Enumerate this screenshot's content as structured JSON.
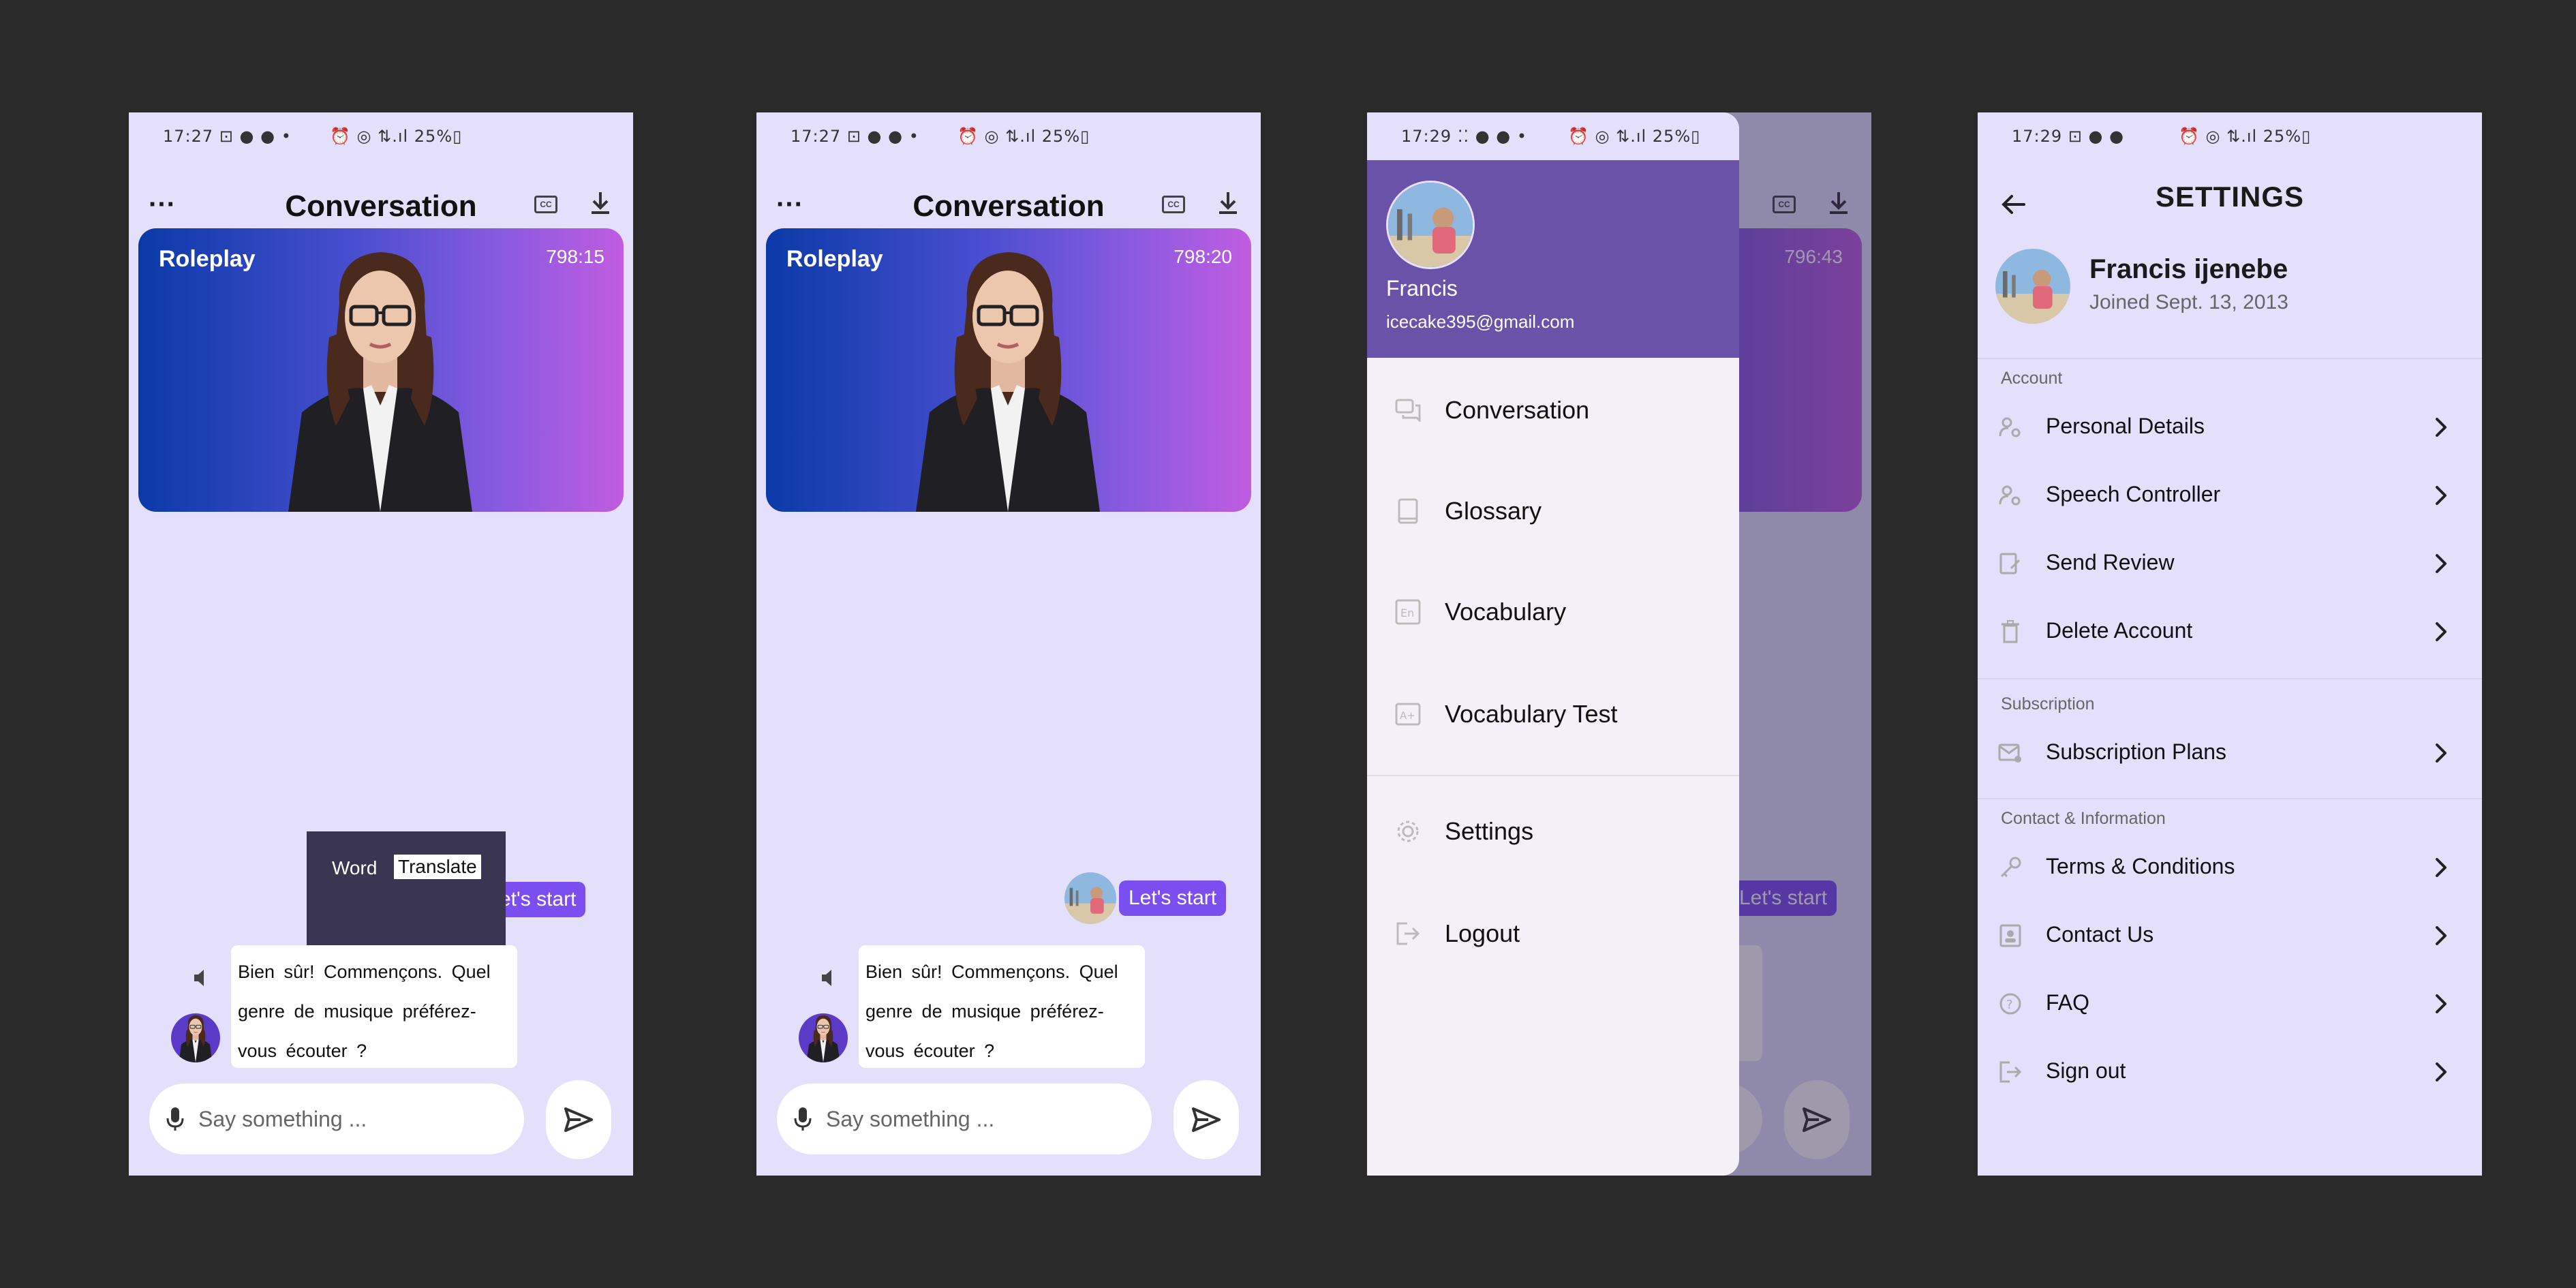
{
  "status": {
    "screen1": {
      "time": "17:27",
      "left_icons": "⊡ ● ● •",
      "right": "⏰ ◎ ⇅.ıl 25%▯"
    },
    "screen2": {
      "time": "17:27",
      "left_icons": "⊡ ● ● •",
      "right": "⏰ ◎ ⇅.ıl 25%▯"
    },
    "screen3": {
      "time": "17:29",
      "left_icons": "⁚⁚ ● ● •",
      "right": "⏰ ◎ ⇅.ıl 25%▯"
    },
    "screen4": {
      "time": "17:29",
      "left_icons": "⊡ ● ●",
      "right": "⏰ ◎ ⇅.ıl 25%▯"
    }
  },
  "conversation": {
    "title": "Conversation",
    "hero_label": "Roleplay",
    "timer1": "798:15",
    "timer2": "798:20",
    "timer3": "796:43",
    "user_msg": "Let's start",
    "user_msg_partial": "et's start",
    "bot_msg": "Bien sûr! Commençons. Quel genre de musique préférez-vous écouter ?",
    "input_placeholder": "Say something ...",
    "popup": {
      "word_label": "Word",
      "translate_label": "Translate"
    }
  },
  "drawer": {
    "user_name": "Francis",
    "email": "icecake395@gmail.com",
    "items": [
      {
        "label": "Conversation",
        "icon": "chat-icon"
      },
      {
        "label": "Glossary",
        "icon": "book-icon"
      },
      {
        "label": "Vocabulary",
        "icon": "vocabulary-icon"
      },
      {
        "label": "Vocabulary Test",
        "icon": "test-icon"
      },
      {
        "label": "Settings",
        "icon": "gear-icon"
      },
      {
        "label": "Logout",
        "icon": "logout-icon"
      }
    ]
  },
  "settings": {
    "title": "SETTINGS",
    "user_name": "Francis ijenebe",
    "joined": "Joined Sept. 13, 2013",
    "sections": {
      "account": "Account",
      "subscription": "Subscription",
      "contact": "Contact & Information"
    },
    "account_items": [
      "Personal Details",
      "Speech Controller",
      "Send Review",
      "Delete Account"
    ],
    "subscription_items": [
      "Subscription Plans"
    ],
    "contact_items": [
      "Terms & Conditions",
      "Contact Us",
      "FAQ",
      "Sign out"
    ]
  },
  "colors": {
    "page_bg": "#2a2a2a",
    "screen_bg": "#e4e0fb",
    "accent": "#7b4ef0",
    "drawer_header": "#6a52a8"
  }
}
